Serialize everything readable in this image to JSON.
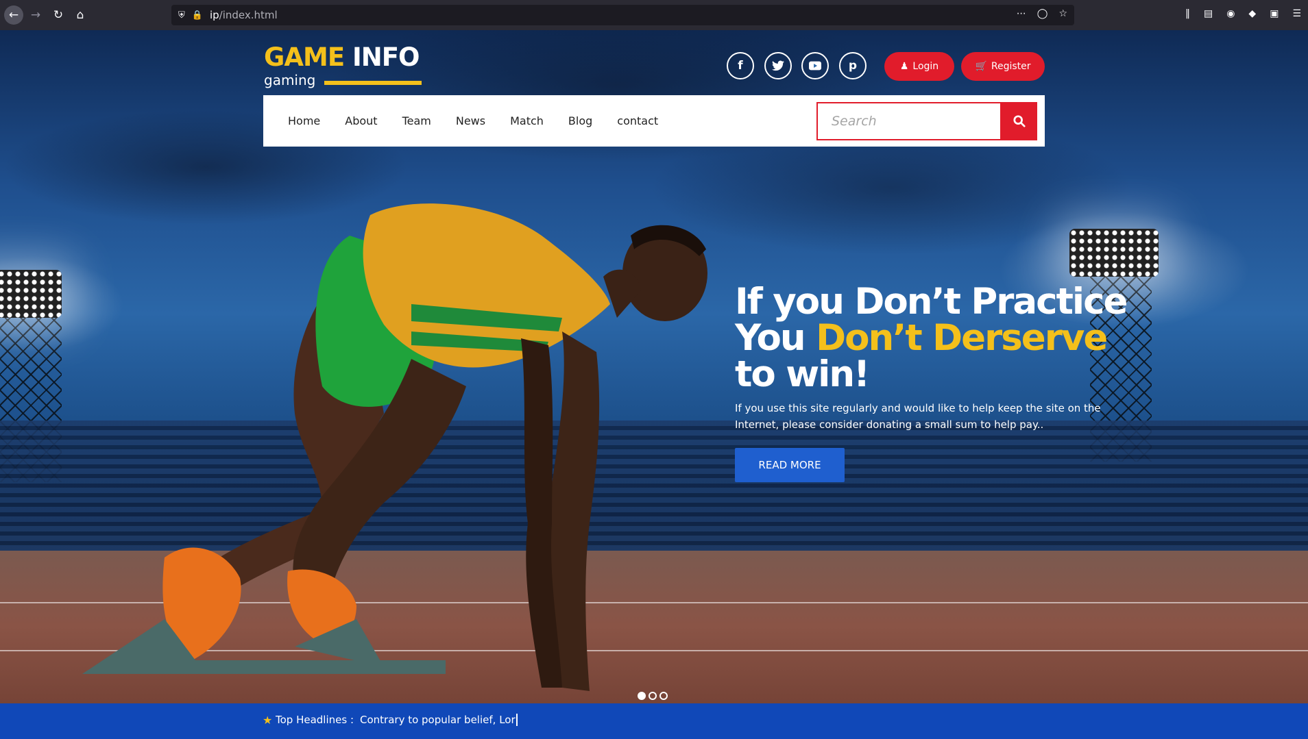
{
  "browser": {
    "url_host": "ip",
    "url_path": "/index.html"
  },
  "header": {
    "logo_game": "GAME",
    "logo_info": "INFO",
    "logo_tagline": "gaming",
    "login_label": "Login",
    "register_label": "Register"
  },
  "nav": {
    "items": [
      "Home",
      "About",
      "Team",
      "News",
      "Match",
      "Blog",
      "contact"
    ]
  },
  "search": {
    "placeholder": "Search"
  },
  "hero": {
    "title_line1": "If you Don’t Practice",
    "title_line2_a": "You ",
    "title_line2_b": "Don’t Derserve",
    "title_line3": "to win!",
    "subtitle": "If you use this site regularly and would like to help keep the site on the Internet, please consider donating a small sum to help pay..",
    "cta_label": "READ MORE"
  },
  "slider": {
    "count": 3,
    "active": 1
  },
  "ticker": {
    "label": "Top Headlines :",
    "text": "Contrary to popular belief, Lor"
  },
  "colors": {
    "accent_red": "#e11c2b",
    "accent_yellow": "#f4c01b",
    "cta_blue": "#1f5fcf",
    "ticker_blue": "#1048b8"
  }
}
